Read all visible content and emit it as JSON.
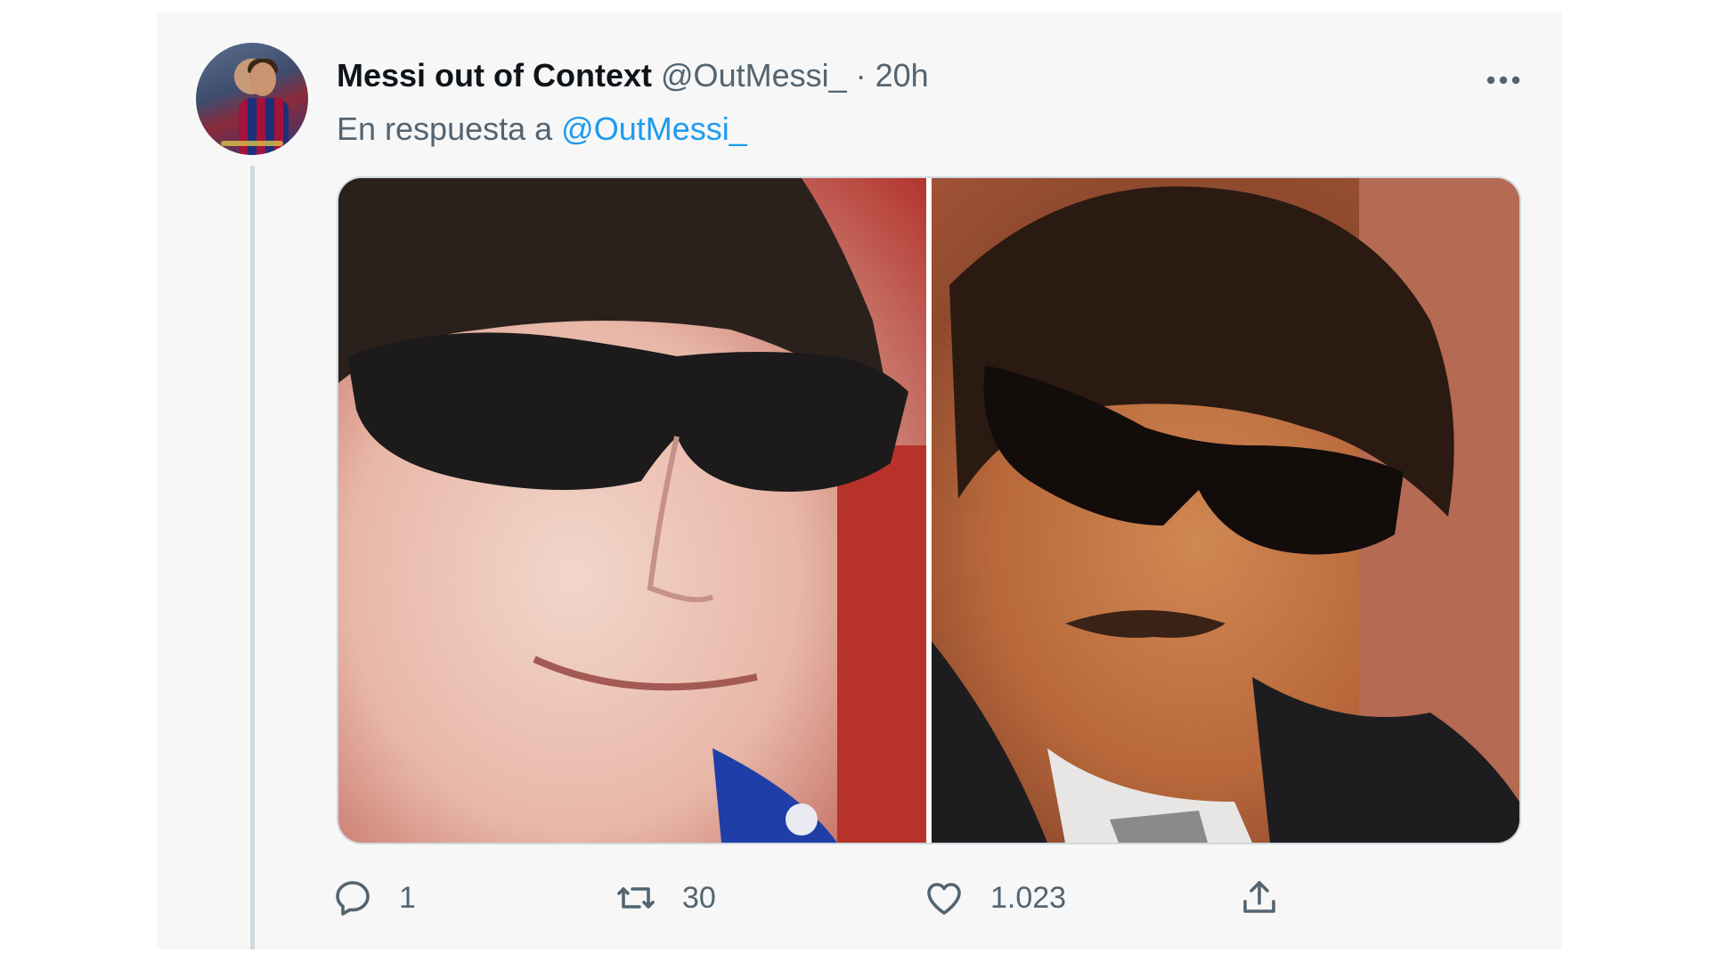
{
  "tweet": {
    "author_name": "Messi out of Context",
    "author_handle": "@OutMessi_",
    "separator": "·",
    "time": "20h",
    "reply_prefix": "En respuesta a",
    "reply_mention": "@OutMessi_"
  },
  "media": {
    "images": [
      {
        "description_icon": "photo-icon"
      },
      {
        "description_icon": "photo-icon"
      }
    ]
  },
  "actions": {
    "reply_count": "1",
    "retweet_count": "30",
    "like_count": "1.023"
  },
  "colors": {
    "link": "#1d9bf0",
    "text_primary": "#0f1419",
    "text_secondary": "#536471",
    "card_background": "#f7f7f7"
  },
  "icons": {
    "more": "more-dots-icon",
    "reply": "reply-bubble-icon",
    "retweet": "retweet-icon",
    "like": "heart-icon",
    "share": "share-upload-icon"
  }
}
